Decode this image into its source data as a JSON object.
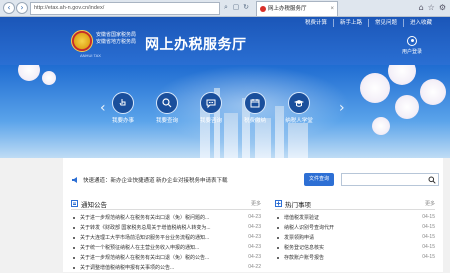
{
  "browser": {
    "address": "http://etax.ah-n.gov.cn/index/",
    "tab_title": "网上办税服务厅",
    "icons": [
      "search-icon",
      "lock-icon",
      "refresh-icon",
      "star-icon"
    ]
  },
  "header": {
    "top_links": [
      "税费计算",
      "新手上路",
      "常见问题",
      "进入收藏"
    ],
    "dept_line1": "安徽省国家税务局",
    "dept_line2": "安徽省地方税务局",
    "dept_en": "ANHUI TAX",
    "title": "网上办税服务厅",
    "login_label": "用户登录"
  },
  "banner": {
    "services": [
      {
        "label": "我要办事",
        "icon": "touch-icon"
      },
      {
        "label": "我要查询",
        "icon": "search-icon"
      },
      {
        "label": "我要咨询",
        "icon": "chat-icon"
      },
      {
        "label": "税费缴纳",
        "icon": "calendar-icon"
      },
      {
        "label": "纳税人学堂",
        "icon": "graduation-cap-icon"
      }
    ]
  },
  "notice_bar": {
    "text": "快速通道：新办企业快捷通道    新办企业对接税务申请表下载",
    "button": "文件查询"
  },
  "announcements": {
    "title": "通知公告",
    "more": "更多",
    "items": [
      {
        "text": "关于进一步规范纳税人在税务有关出口退（免）税问题的...",
        "date": "04-23"
      },
      {
        "text": "关于转发《财政部 国家税务总局关于增值税纳税人转变为...",
        "date": "04-23"
      },
      {
        "text": "关于大连理工大学市场前沿知识服务平台业务流程的通知...",
        "date": "04-23"
      },
      {
        "text": "关于统一个税预征纳税人在主营业务收入申报的通知...",
        "date": "04-23"
      },
      {
        "text": "关于进一步规范纳税人在税务有关出口退（免）税的公告...",
        "date": "04-23"
      },
      {
        "text": "关于调整增值税纳税申报有关事项的公告...",
        "date": "04-22"
      }
    ]
  },
  "hot_items": {
    "title": "热门事项",
    "more": "更多",
    "items": [
      {
        "text": "增值税发票验证",
        "date": "04-15"
      },
      {
        "text": "纳税人识别号查询代开",
        "date": "04-15"
      },
      {
        "text": "发票领购申请",
        "date": "04-15"
      },
      {
        "text": "税务登记信息核实",
        "date": "04-15"
      },
      {
        "text": "存款账户账号报告",
        "date": "04-15"
      }
    ]
  }
}
